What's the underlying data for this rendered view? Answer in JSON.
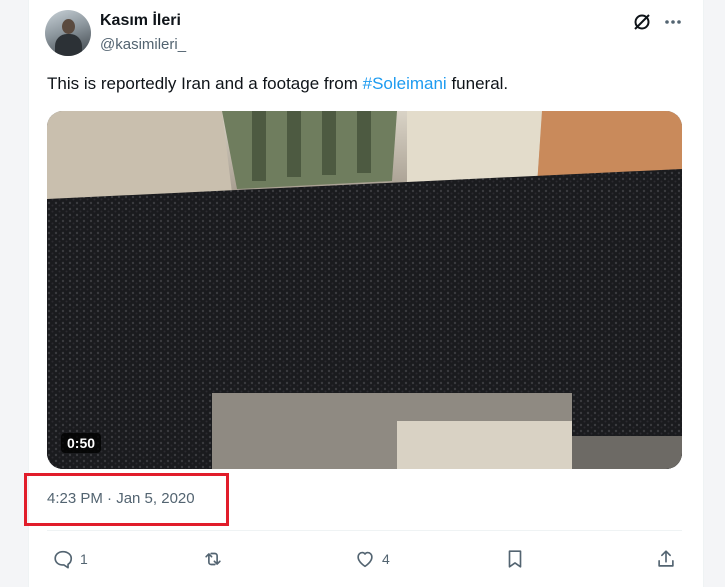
{
  "author": {
    "display_name": "Kasım İleri",
    "handle": "@kasimileri_"
  },
  "tweet": {
    "text_before": "This is reportedly Iran and a footage from ",
    "hashtag": "#Soleimani",
    "text_after": " funeral."
  },
  "media": {
    "duration": "0:50"
  },
  "timestamp": "4:23 PM · Jan 5, 2020",
  "actions": {
    "reply_count": "1",
    "like_count": "4"
  },
  "icons": {
    "grok": "grok-icon",
    "more": "more-icon",
    "reply": "reply-icon",
    "retweet": "retweet-icon",
    "like": "heart-icon",
    "bookmark": "bookmark-icon",
    "share": "share-icon"
  },
  "colors": {
    "link": "#1d9bf0",
    "secondary_text": "#536471",
    "highlight_box": "#e11d2a"
  }
}
